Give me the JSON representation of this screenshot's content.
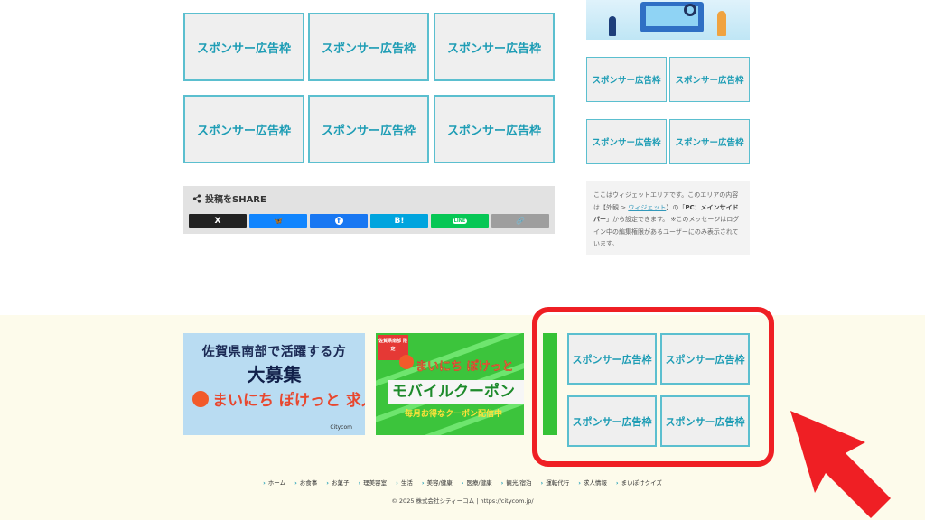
{
  "ads": {
    "label": "スポンサー広告枠"
  },
  "share": {
    "title": "投稿をSHARE",
    "buttons": [
      {
        "name": "x",
        "glyph": "X",
        "color": "#222222"
      },
      {
        "name": "bluesky",
        "glyph": "🦋",
        "color": "#1185fe"
      },
      {
        "name": "facebook",
        "glyph": "f",
        "color": "#1877f2"
      },
      {
        "name": "hatena",
        "glyph": "B!",
        "color": "#00a4de"
      },
      {
        "name": "line",
        "glyph": "LINE",
        "color": "#06c755"
      },
      {
        "name": "copy",
        "glyph": "🔗",
        "color": "#9e9e9e"
      }
    ]
  },
  "widget": {
    "text1": "ここはウィジェットエリアです。このエリアの内容は【外観 > ",
    "link": "ウィジェット",
    "text2": "】の「",
    "bold": "PC：メインサイドバー",
    "text3": "」から設定できます。 ※このメッセージはログイン中の編集権限があるユーザーにのみ表示されています。"
  },
  "banners": {
    "recruit": {
      "line1": "佐賀県南部で活躍する方",
      "line2": "大募集",
      "line3": "まいにち ぽけっと 求人",
      "tag": "Citycom"
    },
    "coupon": {
      "badge": "佐賀県南部\n限定",
      "line1": "まいにち ぽけっと",
      "line2": "モバイルクーポン",
      "line3": "毎月お得なクーポン配信中"
    }
  },
  "footer": {
    "nav": [
      "ホーム",
      "お食事",
      "お菓子",
      "理美容室",
      "生活",
      "美容/健康",
      "医療/健康",
      "観光/宿泊",
      "運転代行",
      "求人情報",
      "まいぽけクイズ"
    ],
    "copyright": "© 2025 株式会社シティーコム | https://citycom.jp/"
  },
  "colors": {
    "ad_border": "#5bbfcf",
    "ad_text": "#1e9db5",
    "highlight": "#ef1f24",
    "footer_bg": "#fdfbeb"
  }
}
